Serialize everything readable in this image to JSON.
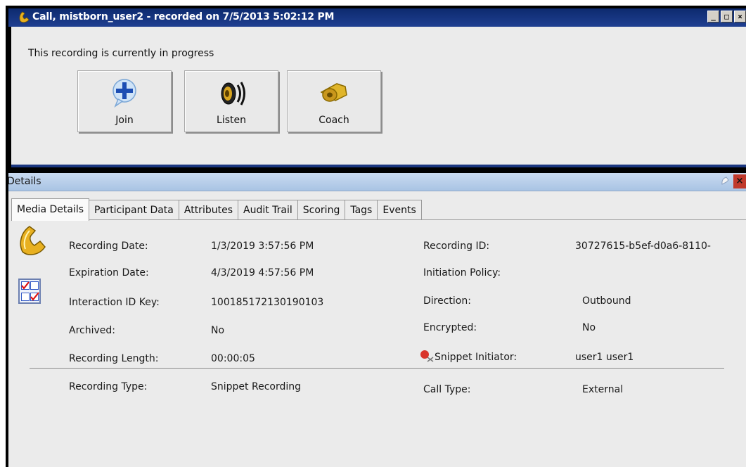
{
  "window": {
    "title": "Call, mistborn_user2 - recorded on 7/5/2013 5:02:12 PM",
    "controls": {
      "minimize": "_",
      "maximize": "□",
      "close": "×"
    }
  },
  "status": "This recording is currently in progress",
  "actions": [
    {
      "label": "Join",
      "icon": "join-plus-icon"
    },
    {
      "label": "Listen",
      "icon": "speaker-icon"
    },
    {
      "label": "Coach",
      "icon": "whistle-icon"
    }
  ],
  "details": {
    "title": "Details",
    "close": "×",
    "tabs": [
      "Media Details",
      "Participant Data",
      "Attributes",
      "Audit Trail",
      "Scoring",
      "Tags",
      "Events"
    ],
    "active_tab": "Media Details",
    "left_fields": [
      {
        "label": "Recording Date:",
        "value": "1/3/2019 3:57:56 PM"
      },
      {
        "label": "Expiration Date:",
        "value": "4/3/2019 4:57:56 PM"
      },
      {
        "label": "Interaction ID Key:",
        "value": "100185172130190103"
      },
      {
        "label": "Archived:",
        "value": "No"
      },
      {
        "label": "Recording Length:",
        "value": "00:00:05"
      },
      {
        "label": "Recording Type:",
        "value": "Snippet Recording"
      }
    ],
    "right_fields": [
      {
        "label": "Recording ID:",
        "value": "30727615-b5ef-d0a6-8110-"
      },
      {
        "label": "Initiation Policy:",
        "value": ""
      },
      {
        "label": "Direction:",
        "value": "Outbound"
      },
      {
        "label": "Encrypted:",
        "value": "No"
      },
      {
        "label": "Snippet Initiator:",
        "value": "user1 user1"
      },
      {
        "label": "Call Type:",
        "value": "External"
      }
    ]
  },
  "colors": {
    "titlebar": "#1f3f91",
    "panel": "#ebebeb",
    "details_bar": "#b9cfea",
    "close_red": "#c0392b"
  }
}
